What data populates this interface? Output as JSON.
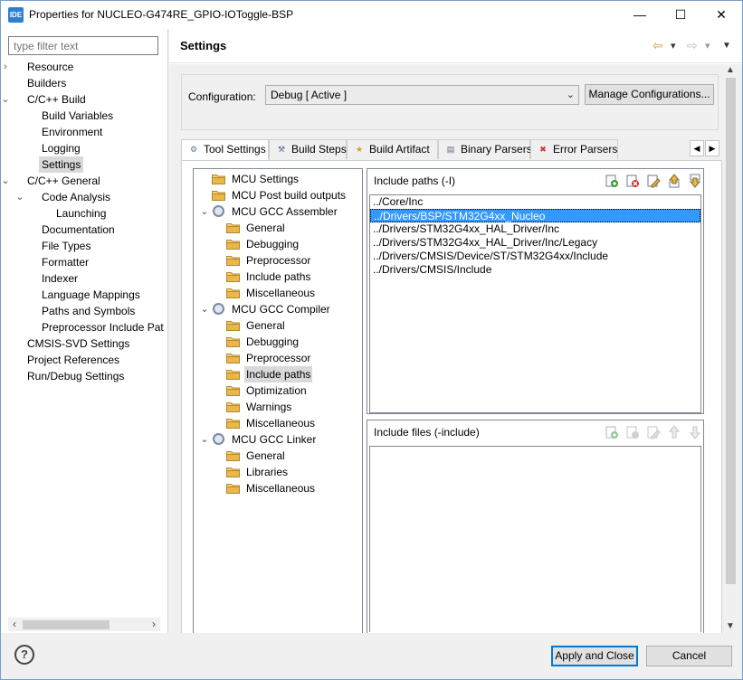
{
  "window": {
    "app_icon": "IDE",
    "title": "Properties for NUCLEO-G474RE_GPIO-IOToggle-BSP",
    "minimize_icon": "—",
    "maximize_icon": "☐",
    "close_icon": "✕"
  },
  "sidebar": {
    "filter_placeholder": "type filter text",
    "items": [
      {
        "label": "Resource",
        "level": 0,
        "arrow": "›"
      },
      {
        "label": "Builders",
        "level": 0,
        "arrow": ""
      },
      {
        "label": "C/C++ Build",
        "level": 0,
        "arrow": "⌄"
      },
      {
        "label": "Build Variables",
        "level": 1,
        "arrow": ""
      },
      {
        "label": "Environment",
        "level": 1,
        "arrow": ""
      },
      {
        "label": "Logging",
        "level": 1,
        "arrow": ""
      },
      {
        "label": "Settings",
        "level": 1,
        "arrow": "",
        "selected": true
      },
      {
        "label": "C/C++ General",
        "level": 0,
        "arrow": "⌄"
      },
      {
        "label": "Code Analysis",
        "level": 1,
        "arrow": "⌄"
      },
      {
        "label": "Launching",
        "level": 2,
        "arrow": ""
      },
      {
        "label": "Documentation",
        "level": 1,
        "arrow": ""
      },
      {
        "label": "File Types",
        "level": 1,
        "arrow": ""
      },
      {
        "label": "Formatter",
        "level": 1,
        "arrow": ""
      },
      {
        "label": "Indexer",
        "level": 1,
        "arrow": ""
      },
      {
        "label": "Language Mappings",
        "level": 1,
        "arrow": ""
      },
      {
        "label": "Paths and Symbols",
        "level": 1,
        "arrow": ""
      },
      {
        "label": "Preprocessor Include Pat",
        "level": 1,
        "arrow": ""
      },
      {
        "label": "CMSIS-SVD Settings",
        "level": 0,
        "arrow": ""
      },
      {
        "label": "Project References",
        "level": 0,
        "arrow": ""
      },
      {
        "label": "Run/Debug Settings",
        "level": 0,
        "arrow": ""
      }
    ]
  },
  "header": {
    "title": "Settings",
    "back_icon": "⇦",
    "forward_icon": "⇨",
    "dropdown_icon": "▾",
    "menu_icon": "▼"
  },
  "config": {
    "label": "Configuration:",
    "value": "Debug  [ Active ]",
    "manage_button": "Manage Configurations..."
  },
  "tabs": [
    {
      "label": "Tool Settings",
      "active": true,
      "icon": "⚙"
    },
    {
      "label": "Build Steps",
      "active": false,
      "icon": "⚒"
    },
    {
      "label": "Build Artifact",
      "active": false,
      "icon": "★"
    },
    {
      "label": "Binary Parsers",
      "active": false,
      "icon": "▤"
    },
    {
      "label": "Error Parsers",
      "active": false,
      "icon": "✖"
    }
  ],
  "tool_tree": [
    {
      "label": "MCU Settings",
      "level": 0,
      "arrow": "",
      "type": "folder"
    },
    {
      "label": "MCU Post build outputs",
      "level": 0,
      "arrow": "",
      "type": "folder"
    },
    {
      "label": "MCU GCC Assembler",
      "level": 0,
      "arrow": "⌄",
      "type": "gear"
    },
    {
      "label": "General",
      "level": 1,
      "arrow": "",
      "type": "folder"
    },
    {
      "label": "Debugging",
      "level": 1,
      "arrow": "",
      "type": "folder"
    },
    {
      "label": "Preprocessor",
      "level": 1,
      "arrow": "",
      "type": "folder"
    },
    {
      "label": "Include paths",
      "level": 1,
      "arrow": "",
      "type": "folder"
    },
    {
      "label": "Miscellaneous",
      "level": 1,
      "arrow": "",
      "type": "folder"
    },
    {
      "label": "MCU GCC Compiler",
      "level": 0,
      "arrow": "⌄",
      "type": "gear"
    },
    {
      "label": "General",
      "level": 1,
      "arrow": "",
      "type": "folder"
    },
    {
      "label": "Debugging",
      "level": 1,
      "arrow": "",
      "type": "folder"
    },
    {
      "label": "Preprocessor",
      "level": 1,
      "arrow": "",
      "type": "folder"
    },
    {
      "label": "Include paths",
      "level": 1,
      "arrow": "",
      "type": "folder",
      "selected": true
    },
    {
      "label": "Optimization",
      "level": 1,
      "arrow": "",
      "type": "folder"
    },
    {
      "label": "Warnings",
      "level": 1,
      "arrow": "",
      "type": "folder"
    },
    {
      "label": "Miscellaneous",
      "level": 1,
      "arrow": "",
      "type": "folder"
    },
    {
      "label": "MCU GCC Linker",
      "level": 0,
      "arrow": "⌄",
      "type": "gear"
    },
    {
      "label": "General",
      "level": 1,
      "arrow": "",
      "type": "folder"
    },
    {
      "label": "Libraries",
      "level": 1,
      "arrow": "",
      "type": "folder"
    },
    {
      "label": "Miscellaneous",
      "level": 1,
      "arrow": "",
      "type": "folder"
    }
  ],
  "include_paths": {
    "title": "Include paths (-I)",
    "items": [
      {
        "path": "../Core/Inc",
        "selected": false
      },
      {
        "path": "../Drivers/BSP/STM32G4xx_Nucleo",
        "selected": true
      },
      {
        "path": "../Drivers/STM32G4xx_HAL_Driver/Inc",
        "selected": false
      },
      {
        "path": "../Drivers/STM32G4xx_HAL_Driver/Inc/Legacy",
        "selected": false
      },
      {
        "path": "../Drivers/CMSIS/Device/ST/STM32G4xx/Include",
        "selected": false
      },
      {
        "path": "../Drivers/CMSIS/Include",
        "selected": false
      }
    ]
  },
  "include_files": {
    "title": "Include files (-include)",
    "items": []
  },
  "footer": {
    "help_icon": "?",
    "apply_close_button": "Apply and Close",
    "cancel_button": "Cancel"
  },
  "colors": {
    "selection": "#3399ff",
    "tree_selection": "#d9d9d9",
    "folder": "#e8b84a",
    "default_button_border": "#0078d7"
  }
}
